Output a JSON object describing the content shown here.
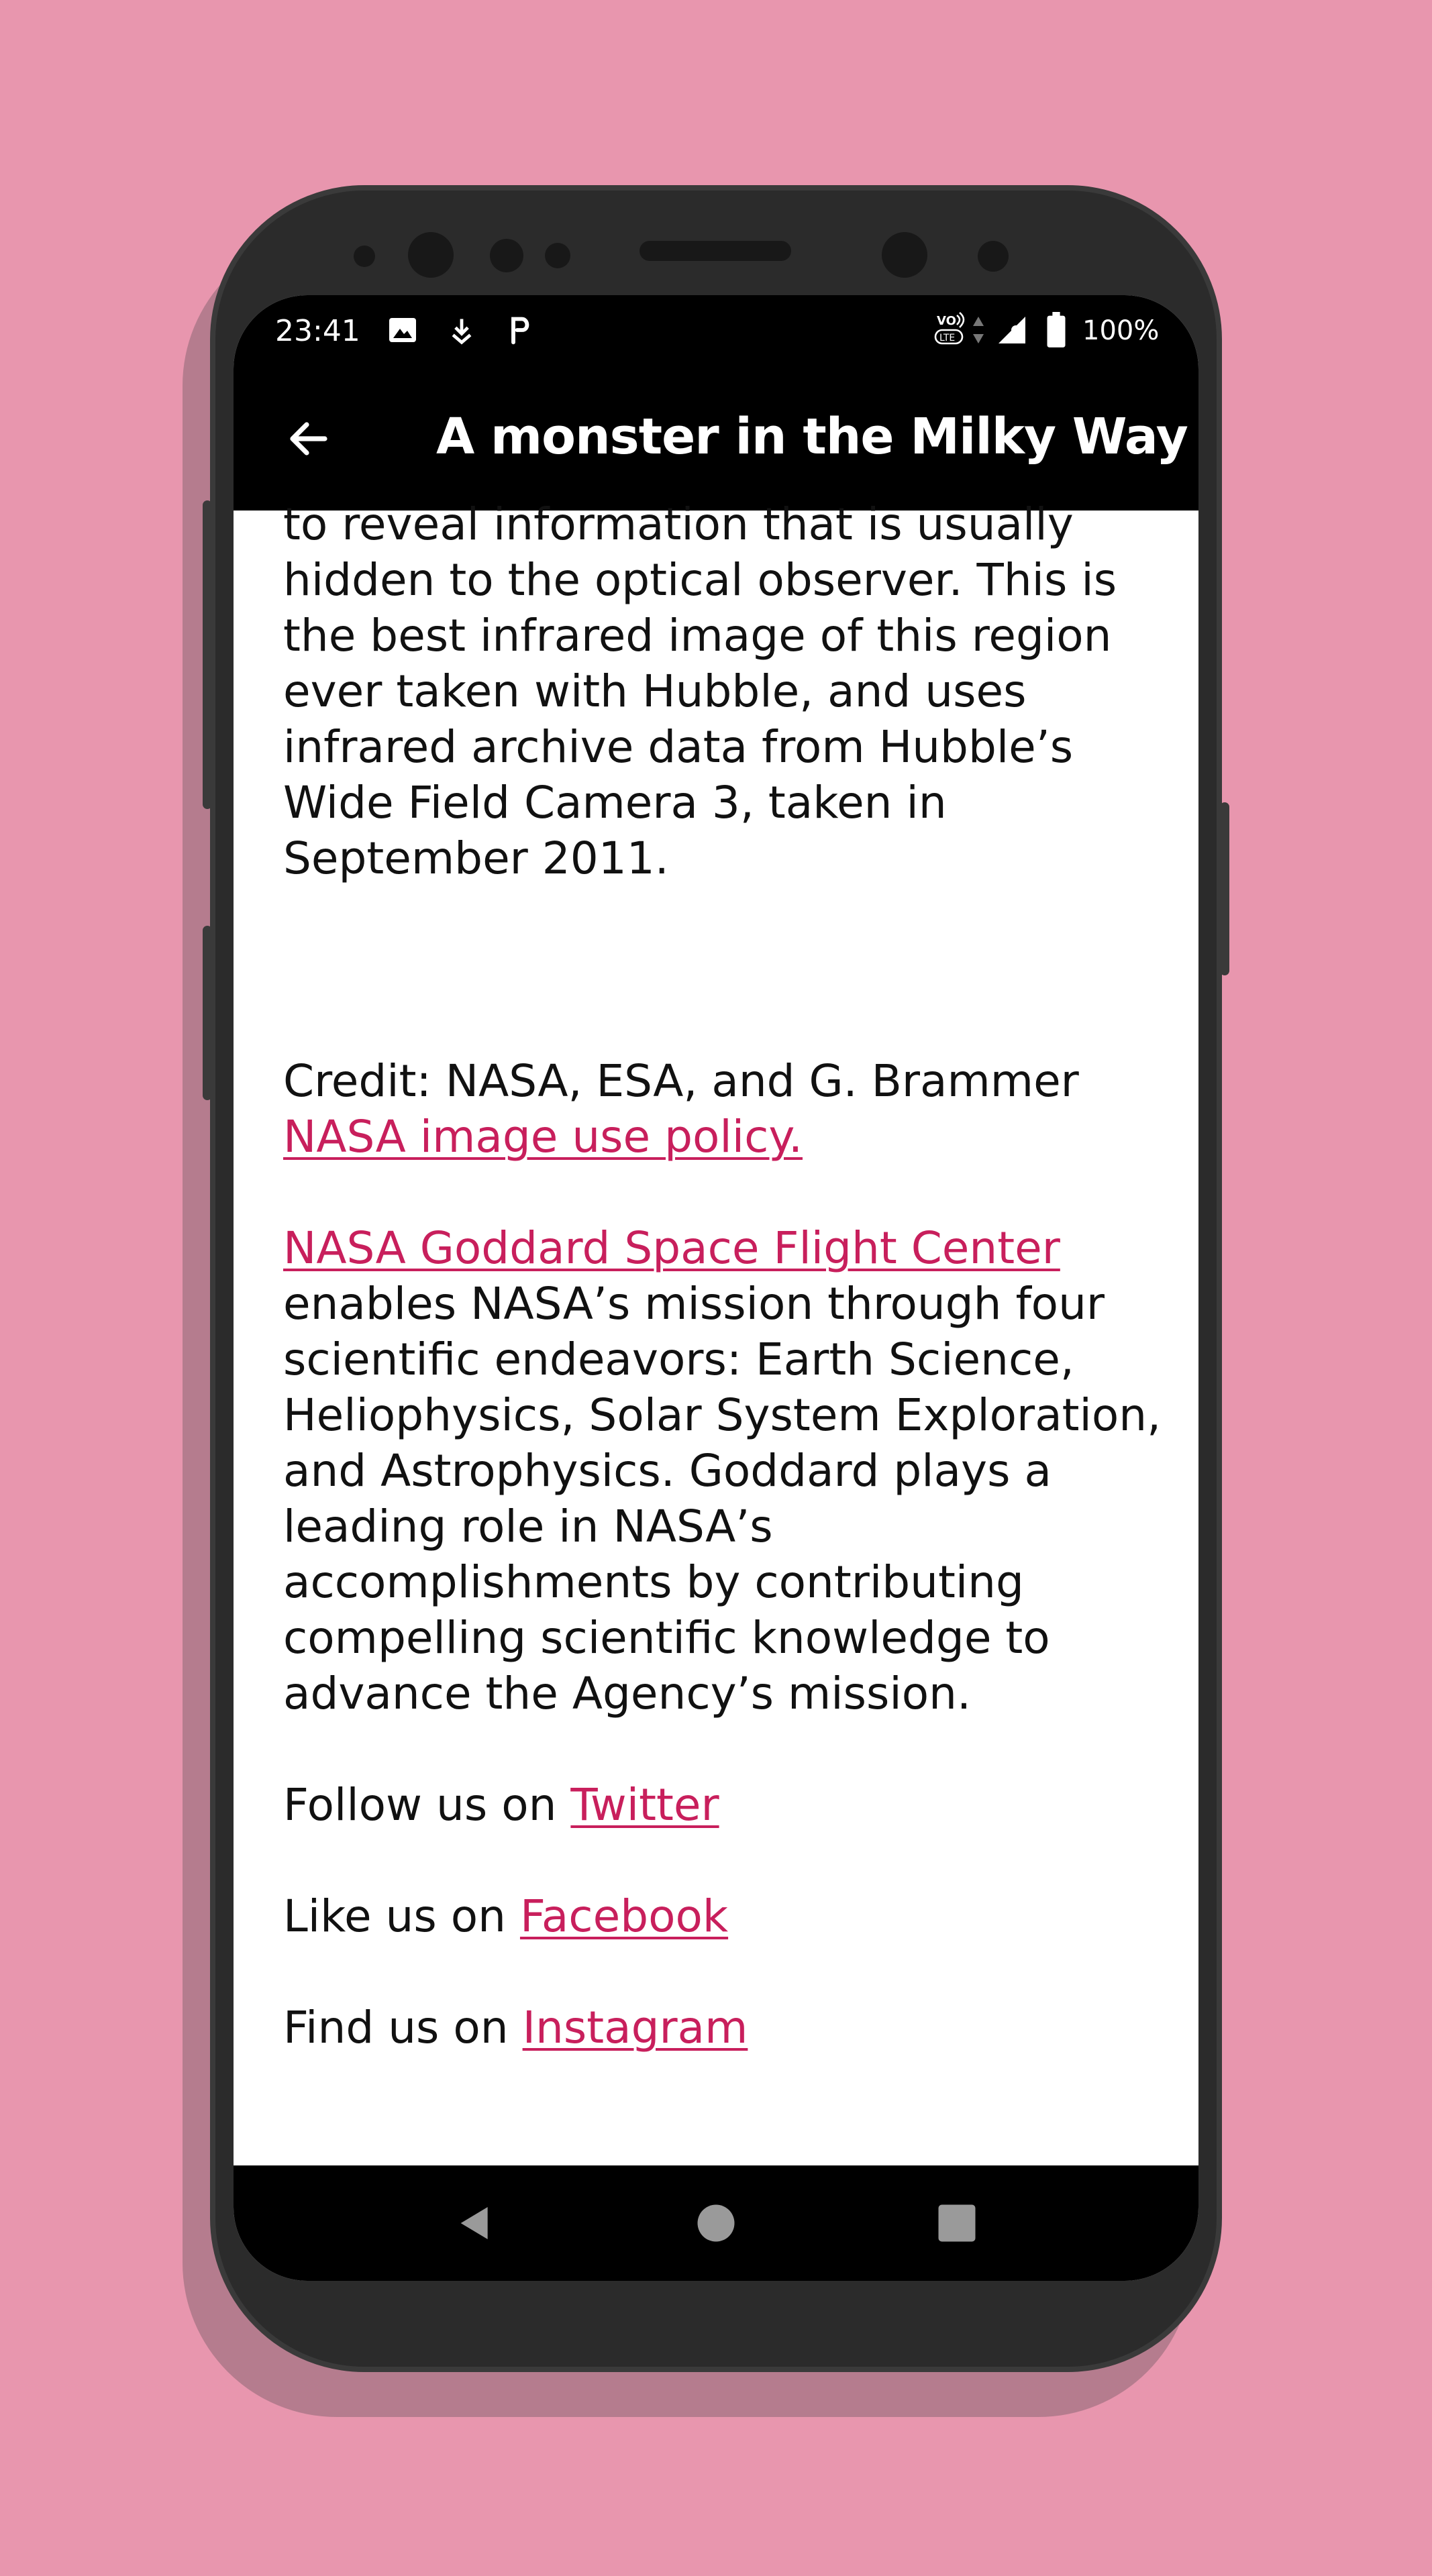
{
  "status_bar": {
    "time": "23:41",
    "battery_percent": "100%",
    "icons": [
      "image-icon",
      "download-icon",
      "p-icon",
      "dot-icon",
      "volte-icon",
      "data-arrows-icon",
      "signal-icon",
      "battery-icon"
    ]
  },
  "app_bar": {
    "title": "A monster in the Milky Way",
    "back_icon": "arrow-back-icon"
  },
  "article": {
    "intro_text": "to reveal information that is usually hidden to the optical observer. This is the best infrared image of this region ever taken with Hubble, and uses infrared archive data from Hubble’s Wide Field Camera 3, taken in September 2011.",
    "credit_text": "Credit: NASA, ESA, and G. Brammer",
    "policy_link": "NASA image use policy.",
    "goddard_link": "NASA Goddard Space Flight Center",
    "goddard_text": "enables NASA’s mission through four scientific endeavors: Earth Science, Heliophysics, Solar System Exploration, and Astrophysics. Goddard plays a leading role in NASA’s accomplishments by contributing compelling scientific knowledge to advance the Agency’s mission.",
    "follow_prefix": "Follow us on ",
    "follow_link": "Twitter",
    "like_prefix": "Like us on ",
    "like_link": "Facebook",
    "find_prefix": "Find us on ",
    "find_link": "Instagram"
  },
  "nav_bar": {
    "buttons": [
      "back-triangle-icon",
      "home-circle-icon",
      "recents-square-icon"
    ]
  },
  "colors": {
    "background": "#e896ae",
    "link": "#c81f5c",
    "bars": "#000000"
  }
}
